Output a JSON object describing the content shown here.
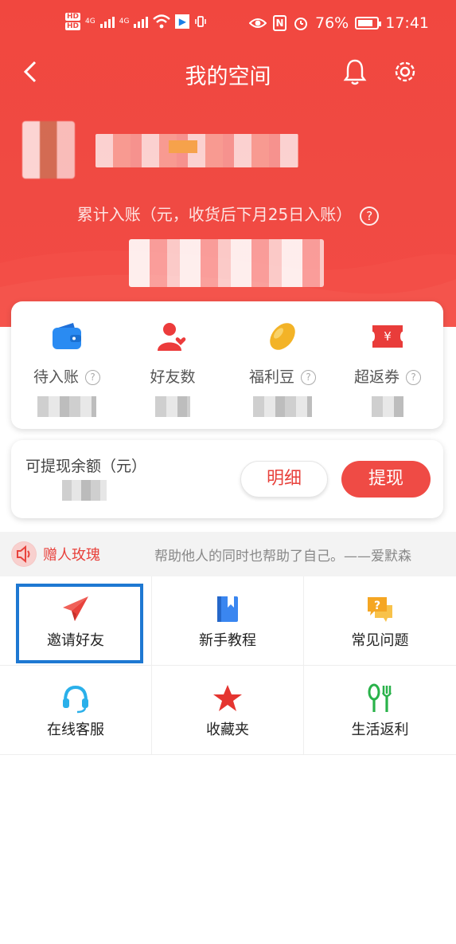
{
  "status_bar": {
    "network_left": "4G",
    "network_right": "4G",
    "battery": "76%",
    "time": "17:41"
  },
  "nav": {
    "title": "我的空间"
  },
  "profile": {
    "earn_label": "累计入账（元，收货后下月25日入账）",
    "help_glyph": "?"
  },
  "stats": [
    {
      "label": "待入账",
      "has_help": true,
      "icon": "wallet-icon",
      "color": "#2a8bf2"
    },
    {
      "label": "好友数",
      "has_help": false,
      "icon": "friends-icon",
      "color": "#ec3b3b"
    },
    {
      "label": "福利豆",
      "has_help": true,
      "icon": "bean-icon",
      "color": "#f3b327"
    },
    {
      "label": "超返券",
      "has_help": true,
      "icon": "coupon-icon",
      "color": "#e93c3a"
    }
  ],
  "withdraw": {
    "label": "可提现余额（元）",
    "detail_label": "明细",
    "withdraw_label": "提现"
  },
  "notice": {
    "tag": "赠人玫瑰",
    "text": "帮助他人的同时也帮助了自己。——爱默森"
  },
  "grid": [
    {
      "label": "邀请好友",
      "icon": "paper-plane-icon"
    },
    {
      "label": "新手教程",
      "icon": "book-icon"
    },
    {
      "label": "常见问题",
      "icon": "question-chat-icon"
    },
    {
      "label": "在线客服",
      "icon": "headset-icon"
    },
    {
      "label": "收藏夹",
      "icon": "star-icon"
    },
    {
      "label": "生活返利",
      "icon": "fork-knife-icon"
    }
  ],
  "colors": {
    "brand_red": "#ef4b45",
    "highlight_blue": "#1e78d2"
  }
}
